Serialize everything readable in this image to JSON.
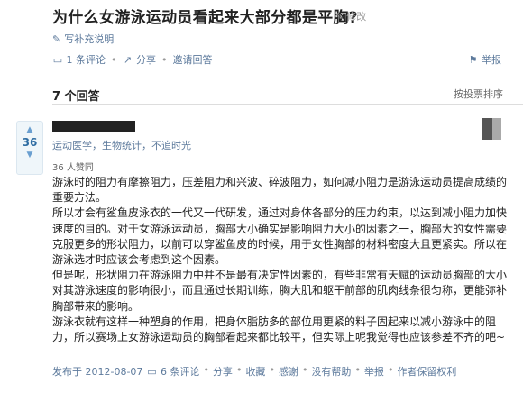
{
  "question": {
    "title": "为什么女游泳运动员看起来大部分都是平胸?",
    "edit_label": "修改",
    "supplement_label": "写补充说明",
    "comments_label": "1 条评论",
    "share_label": "分享",
    "invite_label": "邀请回答",
    "report_label": "举报"
  },
  "answers_header": {
    "count_label": "7 个回答",
    "sort_label": "按投票排序"
  },
  "answer": {
    "votes": "36",
    "bio": "运动医学，生物统计，不追时光",
    "vote_count_text": "36 人赞同",
    "paragraphs": [
      "游泳时的阻力有摩擦阻力，压差阻力和兴波、碎波阻力，如何减小阻力是游泳运动员提高成绩的重要方法。",
      "所以才会有鲨鱼皮泳衣的一代又一代研发，通过对身体各部分的压力约束，以达到减小阻力加快速度的目的。对于女游泳运动员，胸部大小确实是影响阻力大小的因素之一，胸部大的女性需要克服更多的形状阻力，以前可以穿鲨鱼皮的时候，用于女性胸部的材料密度大且更紧实。所以在游泳选才时应该会考虑到这个因素。",
      "但是呢，形状阻力在游泳阻力中并不是最有决定性因素的，有些非常有天赋的运动员胸部的大小对其游泳速度的影响很小，而且通过长期训练，胸大肌和躯干前部的肌肉线条很匀称，更能弥补胸部带来的影响。",
      "游泳衣就有这样一种塑身的作用，把身体脂肪多的部位用更紧的料子固起来以减小游泳中的阻力，所以赛场上女游泳运动员的胸部看起来都比较平，但实际上呢我觉得也应该参差不齐的吧~"
    ],
    "footer": {
      "date": "发布于 2012-08-07",
      "comments": "6 条评论",
      "share": "分享",
      "favorite": "收藏",
      "thanks": "感谢",
      "not_helpful": "没有帮助",
      "report": "举报",
      "rights": "作者保留权利"
    }
  }
}
